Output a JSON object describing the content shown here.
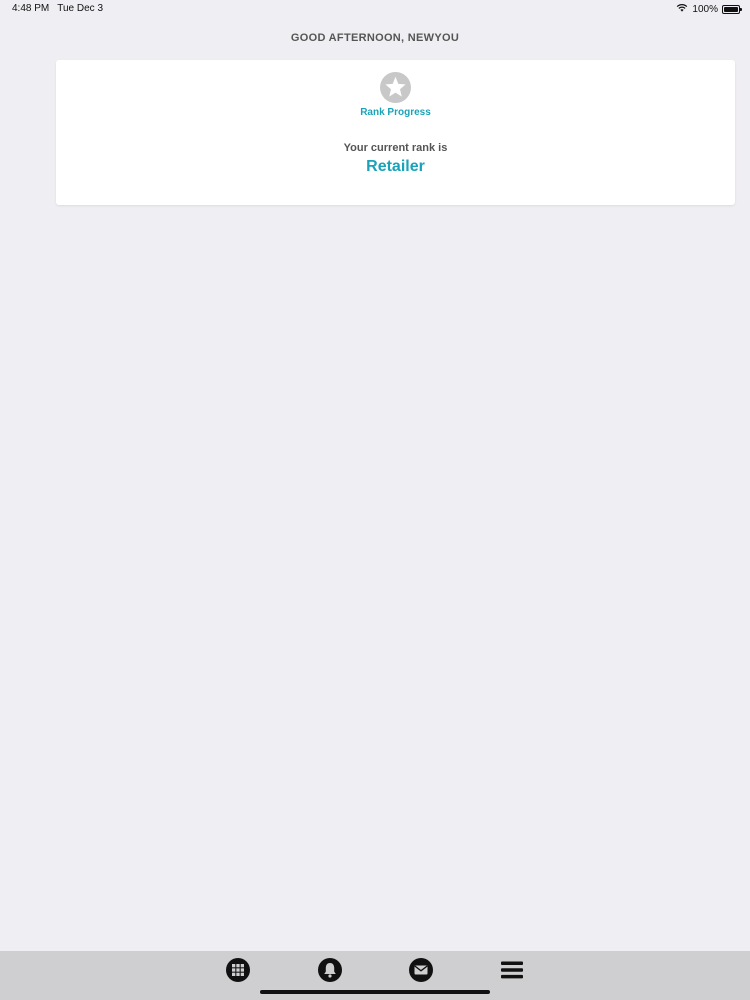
{
  "status_bar": {
    "time": "4:48 PM",
    "date": "Tue Dec 3",
    "battery_text": "100%",
    "battery_level": 1.0,
    "wifi_icon": "wifi-icon",
    "battery_icon": "battery-icon"
  },
  "greeting": "GOOD AFTERNOON, NEWYOU",
  "rank_card": {
    "icon": "star-icon",
    "link_label": "Rank Progress",
    "current_rank_label": "Your current rank is",
    "current_rank_value": "Retailer"
  },
  "tab_bar": {
    "tabs": [
      {
        "icon": "grid-icon"
      },
      {
        "icon": "bell-icon"
      },
      {
        "icon": "mail-icon"
      },
      {
        "icon": "menu-icon"
      }
    ]
  },
  "colors": {
    "accent": "#1aa3b8",
    "background": "#efeef2",
    "tab_bar": "#cfcfd1",
    "muted_text": "#555555",
    "star_gray": "#c8c8c8"
  }
}
